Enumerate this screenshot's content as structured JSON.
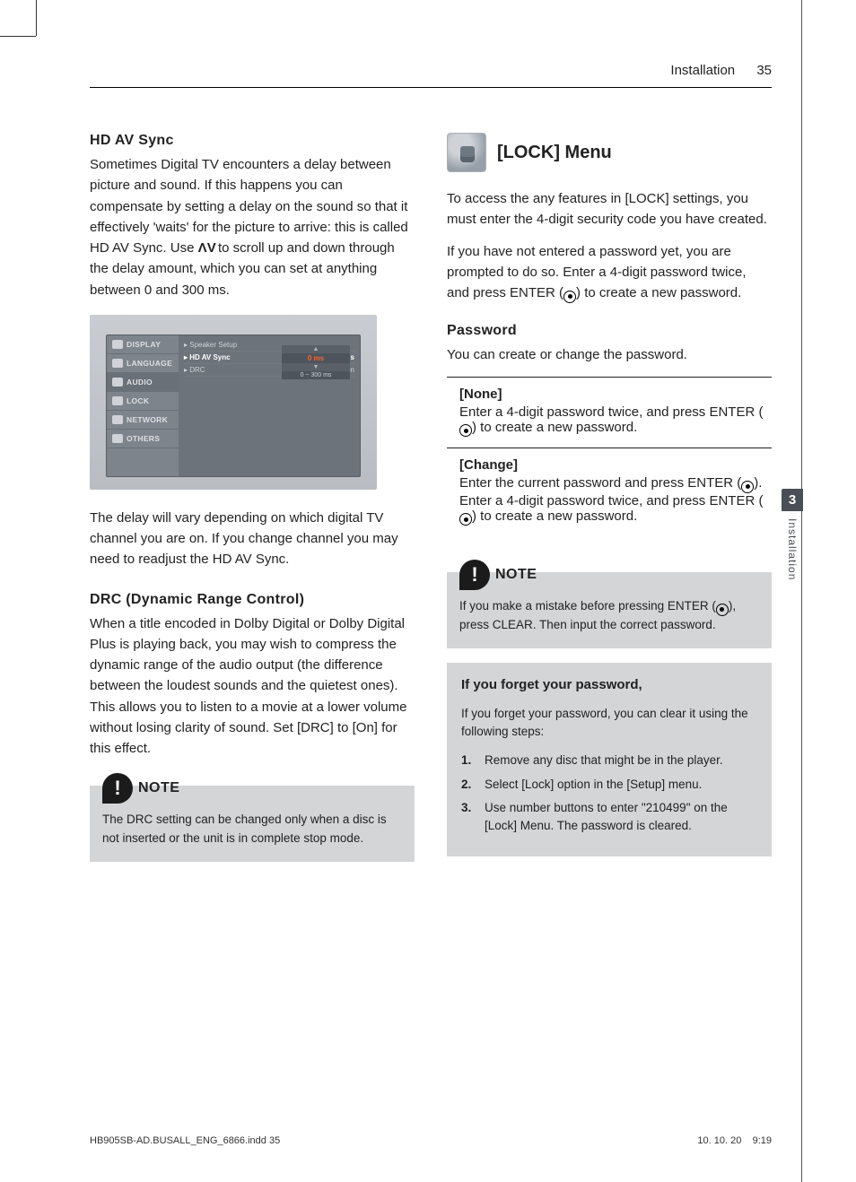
{
  "header": {
    "section": "Installation",
    "page": "35"
  },
  "sideTab": {
    "num": "3",
    "label": "Installation"
  },
  "left": {
    "hdav": {
      "title": "HD AV Sync",
      "p1a": "Sometimes Digital TV encounters a delay between picture and sound. If this happens you can compensate by setting a delay on the sound so that it effectively 'waits' for the picture to arrive: this is called HD AV Sync. Use ",
      "p1b": " to scroll up and down through the delay amount, which you can set at anything between 0 and 300 ms.",
      "p2": "The delay will vary depending on which digital TV channel you are on. If you change channel you may need to readjust the HD AV Sync."
    },
    "screenshot": {
      "menu": [
        "DISPLAY",
        "LANGUAGE",
        "AUDIO",
        "LOCK",
        "NETWORK",
        "OTHERS"
      ],
      "selectedIndex": 2,
      "options": [
        {
          "label": "Speaker Setup",
          "value": ""
        },
        {
          "label": "HD AV Sync",
          "value": ": 0 ms",
          "hi": true
        },
        {
          "label": "DRC",
          "value": ": On"
        }
      ],
      "popup": {
        "top": "▲",
        "value": "0 ms",
        "bottom": "▼",
        "range": "0 ~ 300 ms"
      }
    },
    "drc": {
      "title": "DRC (Dynamic Range Control)",
      "p1": "When a title encoded in Dolby Digital or Dolby Digital Plus is playing back, you may wish to compress the dynamic range of the audio output (the difference between the loudest sounds and the quietest ones). This allows you to listen to a movie at a lower volume without losing clarity of sound. Set [DRC] to [On] for this effect."
    },
    "note": {
      "label": "NOTE",
      "text": "The DRC setting can be changed only when a disc is not inserted or the unit is in complete stop mode."
    }
  },
  "right": {
    "lock": {
      "title": "[LOCK] Menu",
      "p1": "To access the any features in [LOCK] settings, you must enter the 4-digit security code you have created.",
      "p2a": "If you have not entered a password yet, you are prompted to do so. Enter a 4-digit password twice, and press ENTER (",
      "p2b": ") to create a new password."
    },
    "password": {
      "title": "Password",
      "intro": "You can create or change the password.",
      "none": {
        "label": "[None]",
        "t1": "Enter a 4-digit password twice, and press ENTER (",
        "t2": ") to create a new password."
      },
      "change": {
        "label": "[Change]",
        "t1": "Enter the current password and press ENTER (",
        "t2": "). Enter a 4-digit password twice, and press ENTER (",
        "t3": ") to create a new password."
      }
    },
    "note": {
      "label": "NOTE",
      "t1": "If you make a mistake before pressing ENTER (",
      "t2": "), press CLEAR. Then input the correct password."
    },
    "forget": {
      "title": "If you forget your password,",
      "intro": "If you forget your password, you can clear it using the following steps:",
      "steps": [
        "Remove any disc that might be in the player.",
        "Select [Lock] option in the [Setup] menu.",
        "Use number buttons to enter \"210499\" on the [Lock] Menu. The password is cleared."
      ]
    }
  },
  "footer": {
    "file": "HB905SB-AD.BUSALL_ENG_6866.indd   35",
    "date": "10. 10. 20",
    "time": "9:19"
  }
}
